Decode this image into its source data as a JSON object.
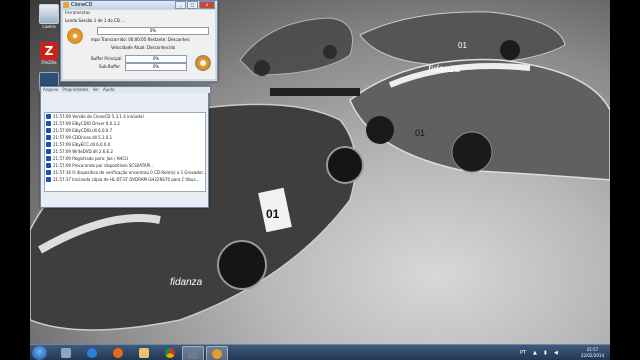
{
  "desktop": {
    "icons": [
      {
        "label": "Lixeira",
        "icon": "recycle-bin-icon"
      },
      {
        "label": "FileZilla",
        "icon": "filezilla-icon"
      },
      {
        "label": "",
        "icon": "program-icon"
      }
    ],
    "wallpaper_text": [
      "fidanza",
      "01",
      "01",
      "01"
    ]
  },
  "clonecd": {
    "title": "CloneCD",
    "inner_title": "Ferramentas",
    "status_line": "Lendo Sessão 1 de 1 do CD ...",
    "progress_top": "0%",
    "time_line": "mpo Transcorrido: 00:00:05  Restante: Desconhec",
    "speed_line": "Velocidade Atual: Desconhecido",
    "buffer_main_label": "Buffer Principal",
    "buffer_main_value": "0%",
    "buffer_sub_label": "Sub Buffer",
    "buffer_sub_value": "0%",
    "tabs": [
      "Arquivo",
      "Propriedades",
      "Ver",
      "Ajuda"
    ],
    "log": [
      "21:57:09 Versão do CloneCD 5.3.1.4 iniciada!",
      "21:57:09 ElbyCDIO Driver 6.0.3.2",
      "21:57:09 ElbyCDIO.dll 6.0.0.7",
      "21:57:09 CDDrives.dll 5.3.0.1",
      "21:57:09 ElbyECC.dll 6.0.0.0",
      "21:57:09 WriteDVD.dll 2.6.6.2",
      "21:57:09 Registrado para: Joe / AHCU",
      "21:57:09 Procurando por dispositivos SCSI/ATAPI...",
      "21:57:16 O dispositivo de verificação encontrou 0 CD-Rom(s) e 1 Gravador...",
      "21:57:37 Iniciando cópia de HL-DT-ST DVDRAM GH22NS70 para C:\\Ibus..."
    ]
  },
  "taskbar": {
    "apps": [
      "windows-explorer-icon",
      "internet-explorer-icon",
      "firefox-icon",
      "folder-icon",
      "chrome-icon",
      "clonecd-taskbar-icon",
      "clonecd-taskbar-icon-2"
    ],
    "language": "PT",
    "time": "21:57",
    "date": "22/02/2014"
  },
  "colors": {
    "accent": "#1f4fb5",
    "taskbar": "#2a4466",
    "window": "#cfd9e6"
  }
}
